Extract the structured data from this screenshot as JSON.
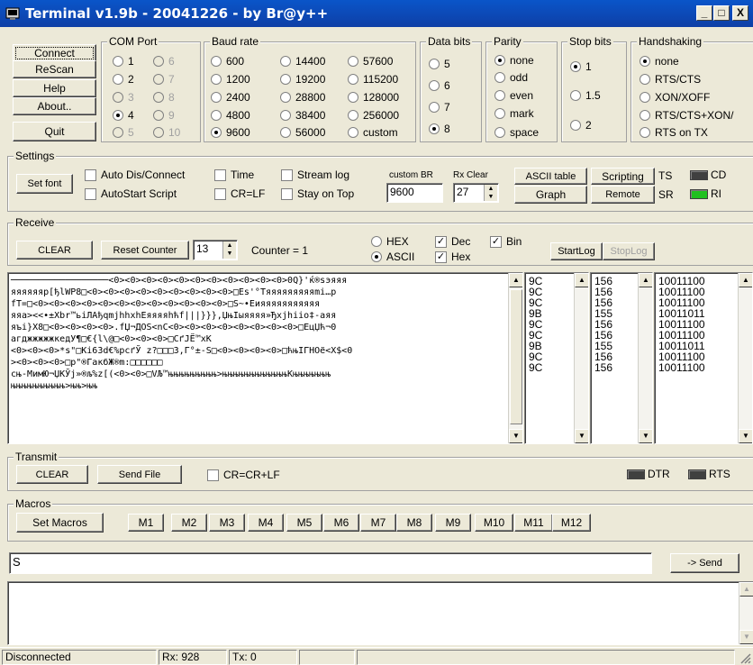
{
  "app": {
    "title": "Terminal v1.9b - 20041226 - by Br@y++",
    "win_min": "_",
    "win_max": "□",
    "win_close": "X"
  },
  "left_buttons": {
    "connect": "Connect",
    "rescan": "ReScan",
    "help": "Help",
    "about": "About..",
    "quit": "Quit"
  },
  "com_port": {
    "label": "COM Port",
    "options": [
      "1",
      "2",
      "3",
      "4",
      "5",
      "6",
      "7",
      "8",
      "9",
      "10"
    ],
    "selected": "4"
  },
  "baud_rate": {
    "label": "Baud rate",
    "options": [
      "600",
      "1200",
      "2400",
      "4800",
      "9600",
      "14400",
      "19200",
      "28800",
      "38400",
      "56000",
      "57600",
      "115200",
      "128000",
      "256000",
      "custom"
    ],
    "selected": "9600"
  },
  "data_bits": {
    "label": "Data bits",
    "options": [
      "5",
      "6",
      "7",
      "8"
    ],
    "selected": "8"
  },
  "parity": {
    "label": "Parity",
    "options": [
      "none",
      "odd",
      "even",
      "mark",
      "space"
    ],
    "selected": "none"
  },
  "stop_bits": {
    "label": "Stop bits",
    "options": [
      "1",
      "1.5",
      "2"
    ],
    "selected": "1"
  },
  "handshaking": {
    "label": "Handshaking",
    "options": [
      "none",
      "RTS/CTS",
      "XON/XOFF",
      "RTS/CTS+XON/",
      "RTS on TX"
    ],
    "selected": "none"
  },
  "settings": {
    "label": "Settings",
    "set_font": "Set font",
    "auto_dis_connect": "Auto Dis/Connect",
    "autostart_script": "AutoStart Script",
    "time": "Time",
    "cr_lf": "CR=LF",
    "stream_log": "Stream log",
    "stay_on_top": "Stay on Top",
    "custom_br_label": "custom BR",
    "custom_br_value": "9600",
    "rx_clear_label": "Rx Clear",
    "rx_clear_value": "27",
    "ascii_table": "ASCII table",
    "graph": "Graph",
    "scripting": "Scripting",
    "remote": "Remote",
    "ts": "TS",
    "cd": "CD",
    "sr": "SR",
    "ri": "RI"
  },
  "receive": {
    "label": "Receive",
    "clear": "CLEAR",
    "reset_counter": "Reset Counter",
    "counter_spin": "13",
    "counter_text": "Counter = 1",
    "hex": "HEX",
    "ascii": "ASCII",
    "dec": "Dec",
    "hex_chk": "Hex",
    "bin": "Bin",
    "start_log": "StartLog",
    "stop_log": "StopLog",
    "ascii_lines": [
      "──────────────────<0><0><0><0><0><0><0><0><0><0><0>0Q}'ќ®ѕэяяя",
      "яяяяяяр[ђlWP8□<0><0><0><0><0><0><0><0><0>□Es'°Тяяяяяяяяяmі…р",
      "fT=□<0><0><0><0><0><0><0><0><0><0><0><0>□S~•Еияяяяяяяяяяя",
      "яяа><<•±Xbr™ьiЛАђqmjhhxhЕяяяяhћf|||}}},ЏњІыяяяя»Ђxjhiio‡-аяя",
      "яъi}X8□<0><0><0><0>.fЏ¬ДОS<nС<0><0><0><0><0><0><0><0>□ЕцЏћ¬0",
      "агджжжжжкедУ¶□€{l\\@□<0><0><0>□СґЈЁ™хК",
      "<0><0><0>*s\"□Кі63d€%pсґЎ z?□□□3,Г°±-S□<0><0><0><0>□ћњІГНОё<Х$<0",
      "><0><0><0>□р\"®ГакбЖ®m:□□□□□□",
      "сњ-МимЮ¬ЏКЎј»®љ%z[(<0><0>□VЉ™њњњњњњњњњ>њњњњњњњњњњњњКњњњњњњњ",
      "њњњњњњњњњњ>њњ>њњ"
    ],
    "hex_values": [
      "9C",
      "9C",
      "9C",
      "9B",
      "9C",
      "9C",
      "9B",
      "9C",
      "9C"
    ],
    "dec_values": [
      "156",
      "156",
      "156",
      "155",
      "156",
      "156",
      "155",
      "156",
      "156"
    ],
    "bin_values": [
      "10011100",
      "10011100",
      "10011100",
      "10011011",
      "10011100",
      "10011100",
      "10011011",
      "10011100",
      "10011100"
    ]
  },
  "transmit": {
    "label": "Transmit",
    "clear": "CLEAR",
    "send_file": "Send File",
    "cr_crlf": "CR=CR+LF",
    "dtr": "DTR",
    "rts": "RTS"
  },
  "macros": {
    "label": "Macros",
    "set_macros": "Set Macros",
    "buttons": [
      "M1",
      "M2",
      "M3",
      "M4",
      "M5",
      "M6",
      "M7",
      "M8",
      "M9",
      "M10",
      "M11",
      "M12"
    ]
  },
  "send": {
    "input_value": "S",
    "send_button": "-> Send"
  },
  "status": {
    "connection": "Disconnected",
    "rx": "Rx: 928",
    "tx": "Tx: 0"
  },
  "colors": {
    "titlebar": "#0a55c9",
    "led_off": "#404040",
    "led_green": "#20c020"
  }
}
